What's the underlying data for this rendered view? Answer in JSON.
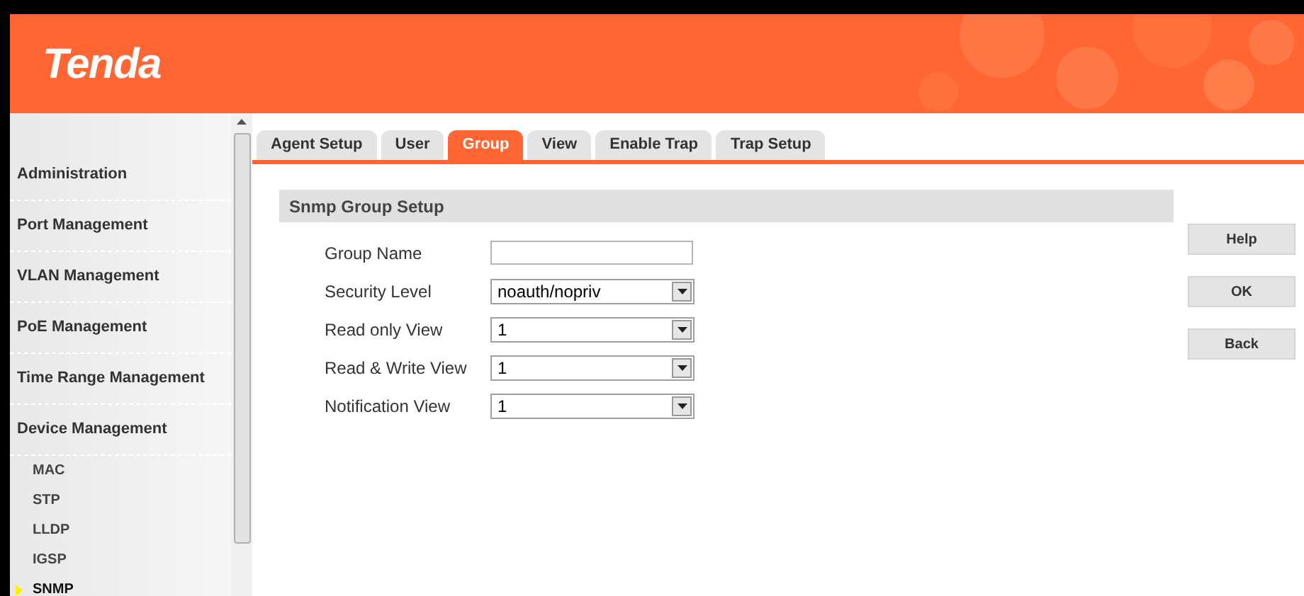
{
  "header": {
    "logo": "Tenda"
  },
  "sidebar": {
    "items": [
      {
        "label": "Administration"
      },
      {
        "label": "Port Management"
      },
      {
        "label": "VLAN Management"
      },
      {
        "label": "PoE Management"
      },
      {
        "label": "Time Range Management"
      },
      {
        "label": "Device Management",
        "children": [
          {
            "label": "MAC",
            "selected": false
          },
          {
            "label": "STP",
            "selected": false
          },
          {
            "label": "LLDP",
            "selected": false
          },
          {
            "label": "IGSP",
            "selected": false
          },
          {
            "label": "SNMP",
            "selected": true
          }
        ]
      }
    ]
  },
  "tabs": [
    {
      "label": "Agent Setup",
      "selected": false
    },
    {
      "label": "User",
      "selected": false
    },
    {
      "label": "Group",
      "selected": true
    },
    {
      "label": "View",
      "selected": false
    },
    {
      "label": "Enable Trap",
      "selected": false
    },
    {
      "label": "Trap Setup",
      "selected": false
    }
  ],
  "section": {
    "title": "Snmp Group Setup"
  },
  "fields": [
    {
      "label": "Group Name",
      "kind": "input"
    },
    {
      "label": "Security Level",
      "kind": "select",
      "value": "noauth/nopriv"
    },
    {
      "label": "Read only View",
      "kind": "select",
      "value": "1"
    },
    {
      "label": "Read & Write View",
      "kind": "select",
      "value": "1"
    },
    {
      "label": "Notification View",
      "kind": "select",
      "value": "1"
    }
  ],
  "buttons": [
    "Help",
    "OK",
    "Back"
  ]
}
